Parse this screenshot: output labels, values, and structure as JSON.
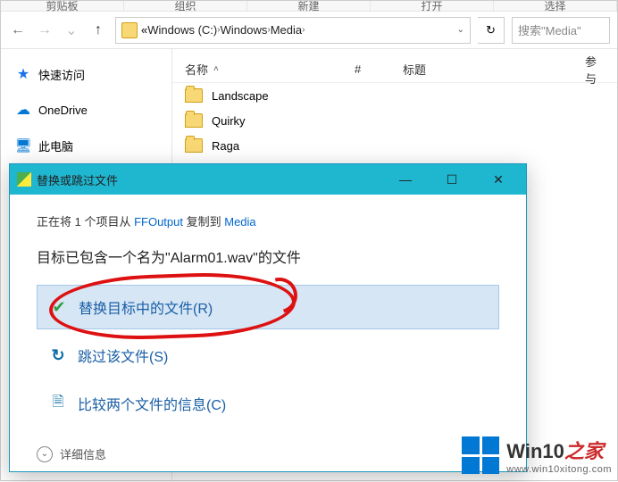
{
  "ribbon": {
    "clipboard": "剪贴板",
    "organize": "组织",
    "new": "新建",
    "open": "打开",
    "select": "选择"
  },
  "nav": {
    "prefix": "«",
    "crumb_drive": "Windows (C:)",
    "crumb_windows": "Windows",
    "crumb_media": "Media"
  },
  "search": {
    "placeholder": "搜索\"Media\""
  },
  "sidebar": {
    "quick": "快速访问",
    "onedrive": "OneDrive",
    "thispc": "此电脑"
  },
  "columns": {
    "name": "名称",
    "hash": "#",
    "title": "标题",
    "participating": "参与"
  },
  "rows": {
    "0": {
      "name": "Landscape"
    },
    "1": {
      "name": "Quirky"
    },
    "2": {
      "name": "Raga"
    }
  },
  "dialog": {
    "title": "替换或跳过文件",
    "status_pre": "正在将 1 个项目从 ",
    "src": "FFOutput",
    "status_mid": " 复制到 ",
    "dst": "Media",
    "msg_pre": "目标已包含一个名为\"",
    "filename": "Alarm01.wav",
    "msg_post": "\"的文件",
    "opt_replace": "替换目标中的文件(R)",
    "opt_skip": "跳过该文件(S)",
    "opt_compare": "比较两个文件的信息(C)",
    "detail": "详细信息"
  },
  "watermark": {
    "brand_prefix": "Win10",
    "brand_suffix": "之家",
    "url": "www.win10xitong.com"
  }
}
